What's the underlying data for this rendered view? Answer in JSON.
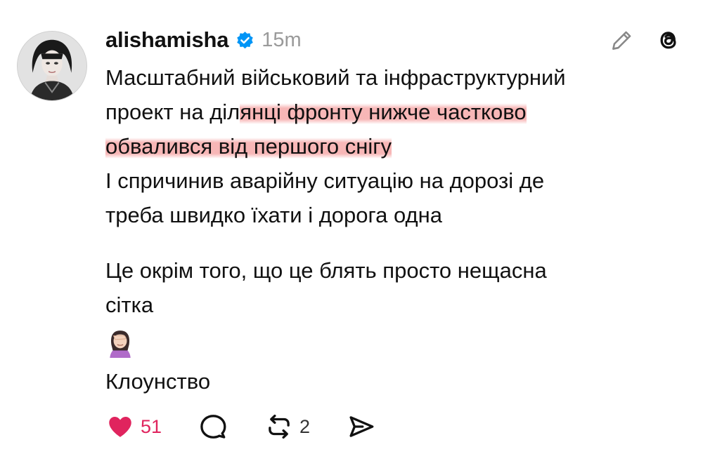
{
  "post": {
    "username": "alishamisha",
    "verified": true,
    "time": "15m",
    "lines": [
      "Масштабний військовий та інфраструктурний",
      "проект на ділянці фронту нижче частково",
      "обвалився від першого снігу",
      "І спричинив аварійну ситуацію на дорозі де",
      "треба швидко їхати і дорога одна",
      "Це окрім того, що це блять просто нещасна",
      "сітка",
      "Клоунство"
    ],
    "highlight": {
      "line2_plain": "проект на діл",
      "line2_marked": "янці фронту нижче частково",
      "line3_marked": "обвалився від першого снігу"
    },
    "emoji": "woman-facepalming-icon"
  },
  "actions": {
    "likes": "51",
    "reposts": "2"
  },
  "colors": {
    "accent_like": "#e0245e",
    "verified": "#0095f6",
    "highlight": "#f6aaaa"
  }
}
